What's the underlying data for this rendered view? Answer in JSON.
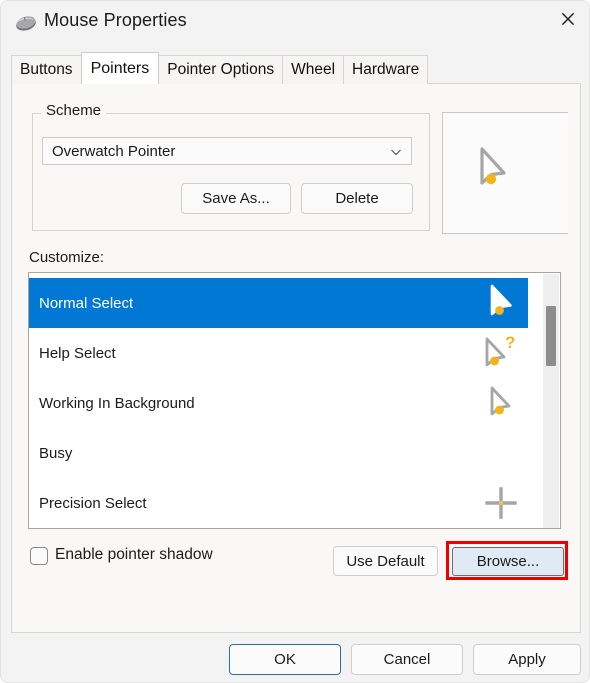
{
  "window": {
    "title": "Mouse Properties",
    "icon": "mouse-icon",
    "close_icon": "close-icon"
  },
  "tabs": [
    {
      "label": "Buttons",
      "active": false
    },
    {
      "label": "Pointers",
      "active": true
    },
    {
      "label": "Pointer Options",
      "active": false
    },
    {
      "label": "Wheel",
      "active": false
    },
    {
      "label": "Hardware",
      "active": false
    }
  ],
  "scheme": {
    "legend": "Scheme",
    "selected": "Overwatch Pointer",
    "chevron_icon": "chevron-down-icon",
    "save_as_label": "Save As...",
    "delete_label": "Delete"
  },
  "preview": {
    "icon": "normal-select-pointer-icon"
  },
  "customize": {
    "label": "Customize:",
    "rows": [
      {
        "label": "Normal Select",
        "icon": "normal-select-pointer-icon",
        "selected": true
      },
      {
        "label": "Help Select",
        "icon": "help-select-pointer-icon",
        "selected": false
      },
      {
        "label": "Working In Background",
        "icon": "working-in-background-pointer-icon",
        "selected": false
      },
      {
        "label": "Busy",
        "icon": "busy-pointer-icon",
        "selected": false
      },
      {
        "label": "Precision Select",
        "icon": "precision-select-crosshair-icon",
        "selected": false
      }
    ]
  },
  "options": {
    "enable_pointer_shadow_label": "Enable pointer shadow",
    "enable_pointer_shadow_checked": false,
    "use_default_label": "Use Default",
    "browse_label": "Browse..."
  },
  "footer": {
    "ok_label": "OK",
    "cancel_label": "Cancel",
    "apply_label": "Apply"
  },
  "colors": {
    "selection_blue": "#0078d4",
    "highlight_red": "#ee0000",
    "pointer_accent": "#f0b619",
    "default_button_border": "#2f6da8"
  }
}
